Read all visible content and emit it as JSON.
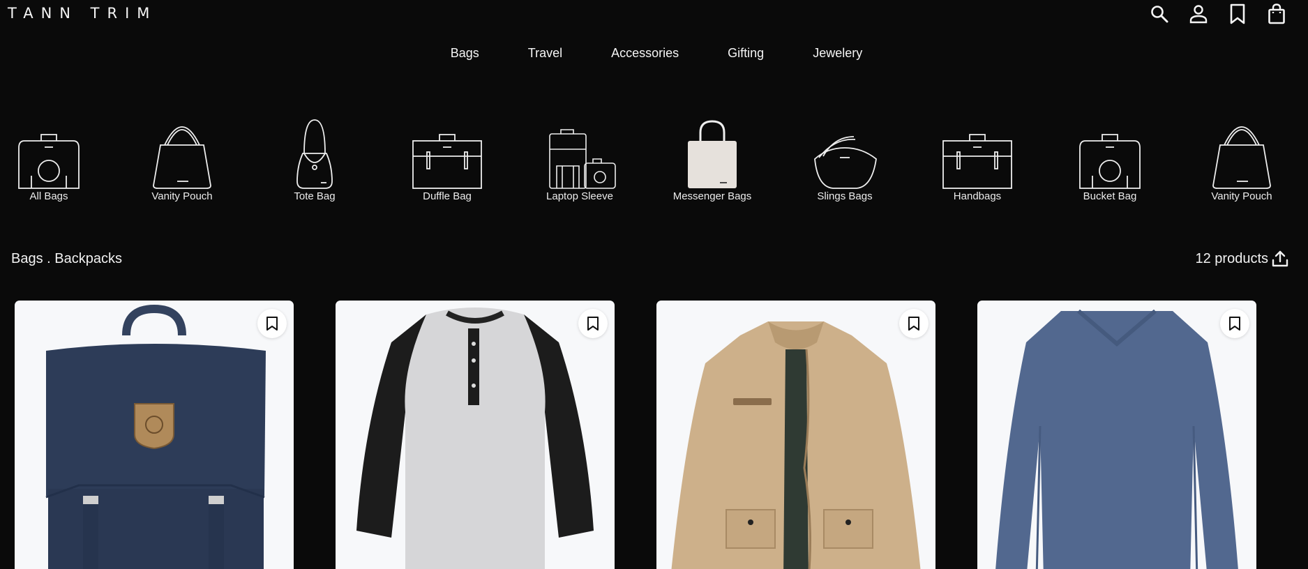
{
  "brand": {
    "logo": "TANN TRIM"
  },
  "header_icons": [
    "search-icon",
    "account-icon",
    "bookmark-icon",
    "shopping-bag-icon"
  ],
  "nav": {
    "items": [
      {
        "label": "Bags"
      },
      {
        "label": "Travel"
      },
      {
        "label": "Accessories"
      },
      {
        "label": "Gifting"
      },
      {
        "label": "Jewelery"
      }
    ]
  },
  "categories": [
    {
      "label": "All Bags",
      "icon": "camera-bag-icon"
    },
    {
      "label": "Vanity Pouch",
      "icon": "handbag-icon"
    },
    {
      "label": "Tote Bag",
      "icon": "tote-bag-icon"
    },
    {
      "label": "Duffle Bag",
      "icon": "briefcase-icon"
    },
    {
      "label": "Laptop Sleeve",
      "icon": "luggage-set-icon"
    },
    {
      "label": "Messenger Bags",
      "icon": "shopping-tote-icon"
    },
    {
      "label": "Slings Bags",
      "icon": "sling-bag-icon"
    },
    {
      "label": "Handbags",
      "icon": "briefcase-icon"
    },
    {
      "label": "Bucket Bag",
      "icon": "camera-bag-icon"
    },
    {
      "label": "Vanity Pouch",
      "icon": "handbag-icon"
    }
  ],
  "listing": {
    "breadcrumb": "Bags . Backpacks",
    "count": "12 products"
  },
  "products": [
    {
      "image": "navy-backpack",
      "color": "#2b3a55"
    },
    {
      "image": "raglan-henley-tee",
      "color": "#d9d9d9"
    },
    {
      "image": "khaki-jacket",
      "color": "#cdb08a"
    },
    {
      "image": "blue-vneck-longsleeve",
      "color": "#52688f"
    }
  ],
  "colors": {
    "background": "#0a0a0a",
    "text": "#f2f2f2",
    "card": "#f7f8fa"
  }
}
